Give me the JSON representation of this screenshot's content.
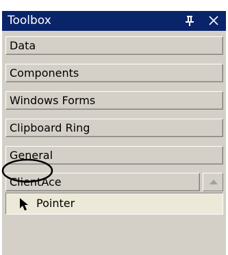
{
  "toolbox": {
    "title": "Toolbox",
    "pin_icon": "pin-icon",
    "close_icon": "close-icon",
    "tabs": [
      {
        "label": "Data"
      },
      {
        "label": "Components"
      },
      {
        "label": "Windows Forms"
      },
      {
        "label": "Clipboard Ring"
      },
      {
        "label": "General"
      },
      {
        "label": "ClientAce",
        "active": true
      }
    ],
    "scroll_up_icon": "scroll-up-arrow-icon",
    "items": [
      {
        "label": "Pointer",
        "icon": "pointer-arrow-icon",
        "selected": true
      }
    ]
  },
  "colors": {
    "title_bar": "#0a246a",
    "panel": "#d4d0c8",
    "selected_item": "#ece9d8",
    "annotation": "#000000"
  }
}
